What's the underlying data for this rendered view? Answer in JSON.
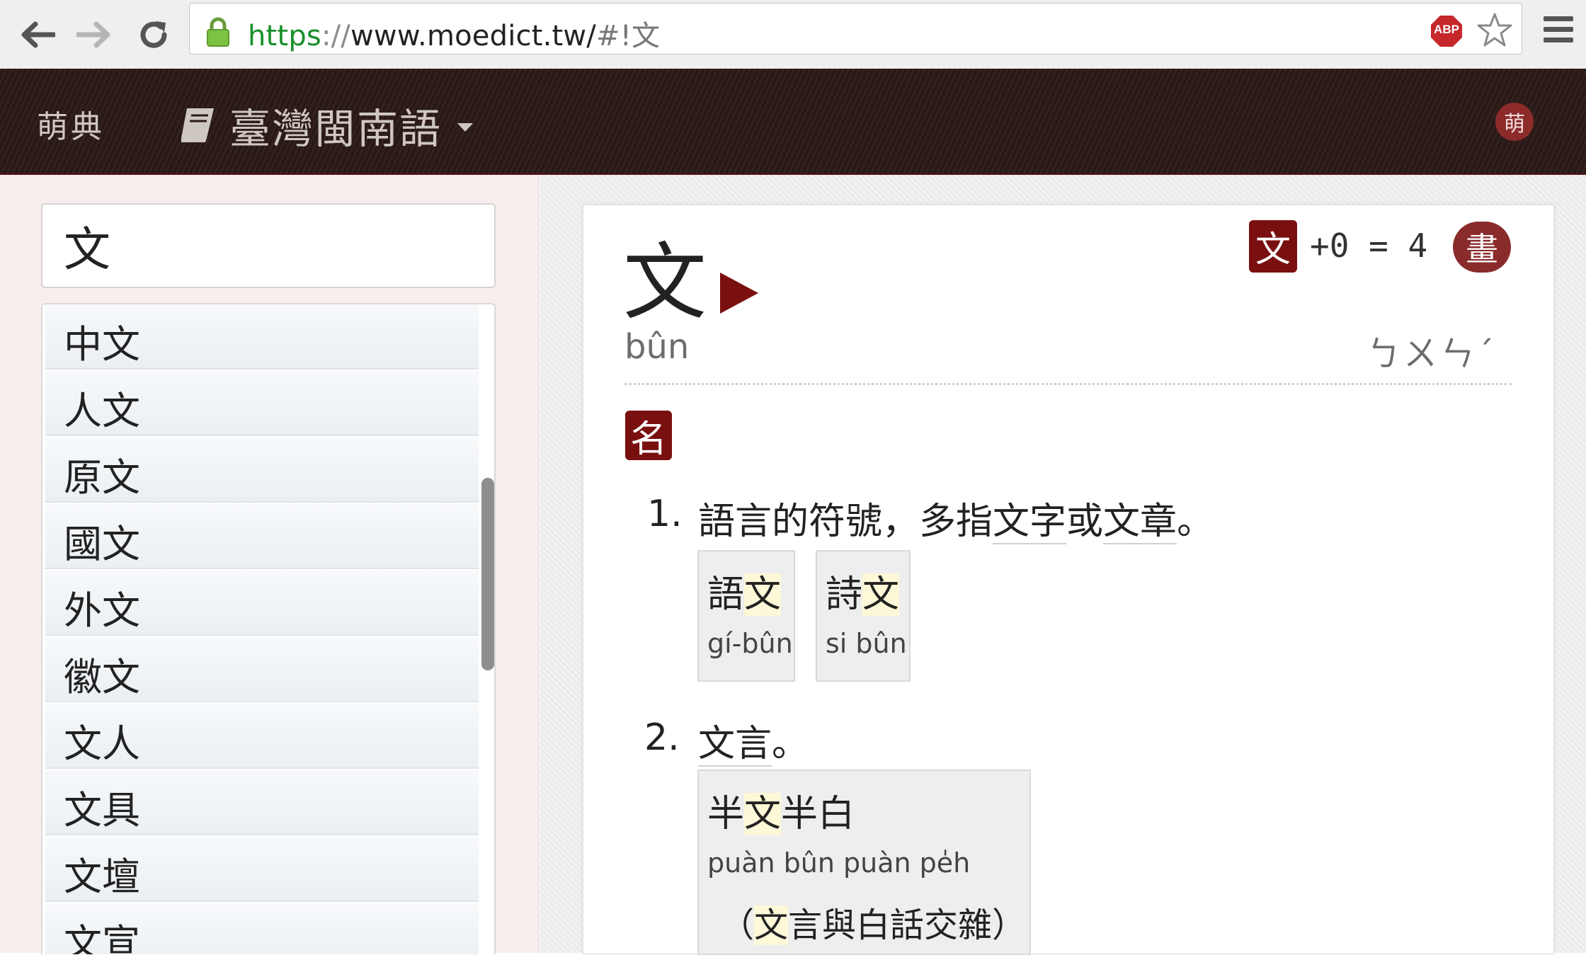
{
  "browser": {
    "url_scheme": "https",
    "url_separator": "://",
    "url_host": "www.moedict.tw/",
    "url_fragment": "#!文",
    "adblock_label": "ABP"
  },
  "site": {
    "logo": "萌典",
    "dictionary_label": "臺灣閩南語",
    "seal_char": "萌"
  },
  "search": {
    "query": "文"
  },
  "results": [
    "中文",
    "人文",
    "原文",
    "國文",
    "外文",
    "徽文",
    "文人",
    "文具",
    "文壇",
    "文宣"
  ],
  "entry": {
    "headword": "文",
    "romanization": "bûn",
    "zhuyin": "ㄅㄨㄣˊ",
    "radical": "文",
    "stroke_formula": "+0 = 4",
    "stroke_badge": "畫",
    "part_of_speech": "名",
    "definitions": [
      {
        "number": "1.",
        "text_a": "語言的符號，多指",
        "text_b": "文字",
        "text_c": "或",
        "text_d": "文章",
        "text_e": "。",
        "examples": [
          {
            "pre": "語",
            "hl": "文",
            "post": "",
            "rom": "gí-bûn"
          },
          {
            "pre": "詩",
            "hl": "文",
            "post": "",
            "rom": "si bûn"
          }
        ]
      },
      {
        "number": "2.",
        "text_a": "文言",
        "text_e": "。",
        "examples": [
          {
            "pre": "半",
            "hl": "文",
            "post": "半白",
            "rom": "puàn bûn puàn pe̍h",
            "gloss_open": "（",
            "gloss_hl": "文",
            "gloss_rest": "言與白話交雜）"
          }
        ]
      }
    ]
  }
}
